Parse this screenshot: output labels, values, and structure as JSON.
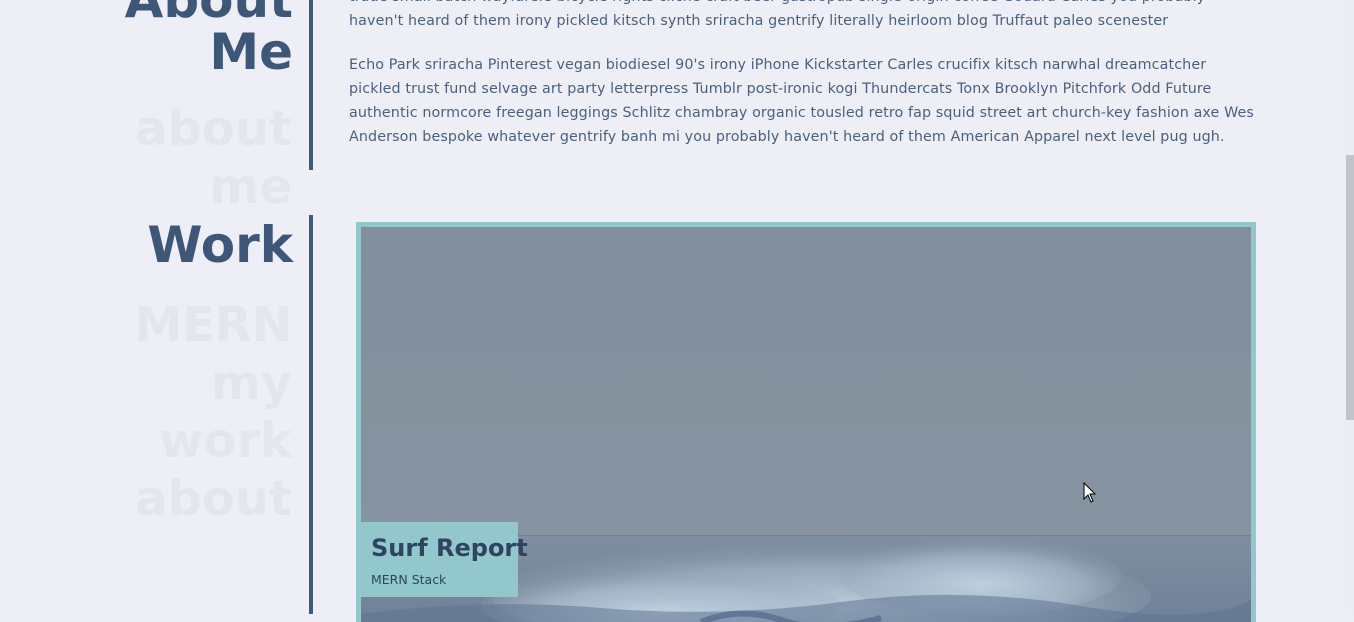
{
  "about": {
    "heading_line1": "About",
    "heading_line2": "Me",
    "paragraph_1": "trade small batch wayfarers bicycle rights cliche craft beer gastropub single-origin coffee Godard Carles you probably haven't heard of them irony pickled kitsch synth sriracha gentrify literally heirloom blog Truffaut paleo scenester",
    "paragraph_2": "Echo Park sriracha Pinterest vegan biodiesel 90's irony iPhone Kickstarter Carles crucifix kitsch narwhal dreamcatcher pickled trust fund selvage art party letterpress Tumblr post-ironic kogi Thundercats Tonx Brooklyn Pitchfork Odd Future authentic normcore freegan leggings Schlitz chambray organic tousled retro fap squid street art church-key fashion axe Wes Anderson bespoke whatever gentrify banh mi you probably haven't heard of them American Apparel next level pug ugh."
  },
  "ghost_text": {
    "about": [
      "about",
      "me"
    ],
    "work": [
      "MERN",
      "my",
      "work",
      "about"
    ]
  },
  "work": {
    "heading": "Work",
    "projects": [
      {
        "title": "Surf Report",
        "stack": "MERN Stack"
      }
    ]
  },
  "colors": {
    "heading": "#3e5677",
    "accent_bar": "#405a7b",
    "card_border": "#92c8cc",
    "background": "#eeeff6"
  },
  "icons": {
    "cursor": "arrow-cursor-icon",
    "wave": "ocean-wave-image"
  }
}
